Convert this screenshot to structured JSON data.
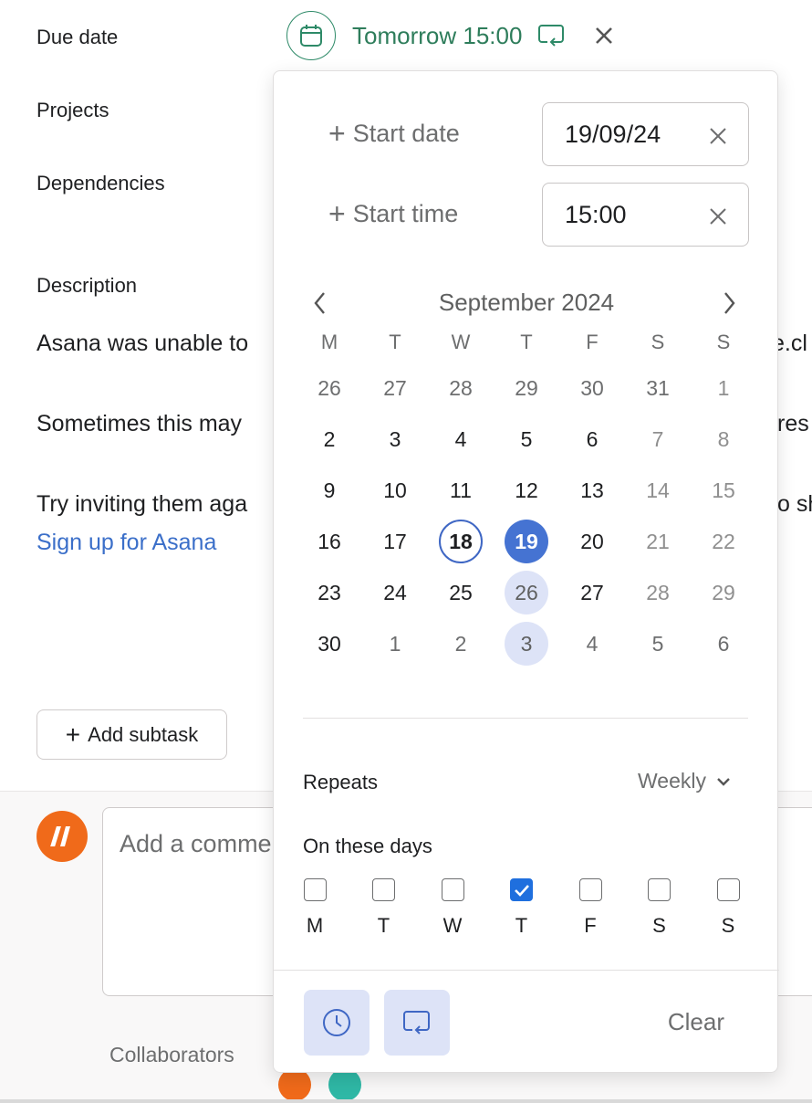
{
  "fields": {
    "due_date_label": "Due date",
    "projects_label": "Projects",
    "dependencies_label": "Dependencies",
    "description_label": "Description"
  },
  "due": {
    "value": "Tomorrow 15:00",
    "accent_color": "#2e7d5b"
  },
  "description": {
    "line1_left": "Asana was unable to",
    "line1_right": "e.cl",
    "line2_left": "Sometimes this may",
    "line2_right": "res",
    "line3_left": "Try inviting them aga",
    "line3_right": "o sh",
    "link": "Sign up for Asana"
  },
  "subtask": {
    "label": "Add subtask"
  },
  "comment": {
    "placeholder": "Add a comme",
    "collaborators_label": "Collaborators"
  },
  "picker": {
    "start_date_label": "Start date",
    "start_date_value": "19/09/24",
    "start_time_label": "Start time",
    "start_time_value": "15:00",
    "month_title": "September 2024",
    "weekday_headers": [
      "M",
      "T",
      "W",
      "T",
      "F",
      "S",
      "S"
    ],
    "weeks": [
      [
        "26",
        "27",
        "28",
        "29",
        "30",
        "31",
        "1"
      ],
      [
        "2",
        "3",
        "4",
        "5",
        "6",
        "7",
        "8"
      ],
      [
        "9",
        "10",
        "11",
        "12",
        "13",
        "14",
        "15"
      ],
      [
        "16",
        "17",
        "18",
        "19",
        "20",
        "21",
        "22"
      ],
      [
        "23",
        "24",
        "25",
        "26",
        "27",
        "28",
        "29"
      ],
      [
        "30",
        "1",
        "2",
        "3",
        "4",
        "5",
        "6"
      ]
    ],
    "today": "18",
    "selected": "19",
    "repeat_days": [
      "26",
      "3"
    ],
    "repeats_label": "Repeats",
    "repeats_value": "Weekly",
    "on_days_label": "On these days",
    "day_letters": [
      "M",
      "T",
      "W",
      "T",
      "F",
      "S",
      "S"
    ],
    "day_checked": [
      false,
      false,
      false,
      true,
      false,
      false,
      false
    ],
    "clear_label": "Clear",
    "selected_color": "#4573d2",
    "highlight_color": "#dde3f7"
  },
  "icons": {
    "calendar": "calendar-icon",
    "repeat": "repeat-icon",
    "close": "close-icon",
    "clock": "clock-icon",
    "chevron_left": "chevron-left-icon",
    "chevron_right": "chevron-right-icon",
    "chevron_down": "chevron-down-icon",
    "avatar": "asana-logo-avatar"
  }
}
